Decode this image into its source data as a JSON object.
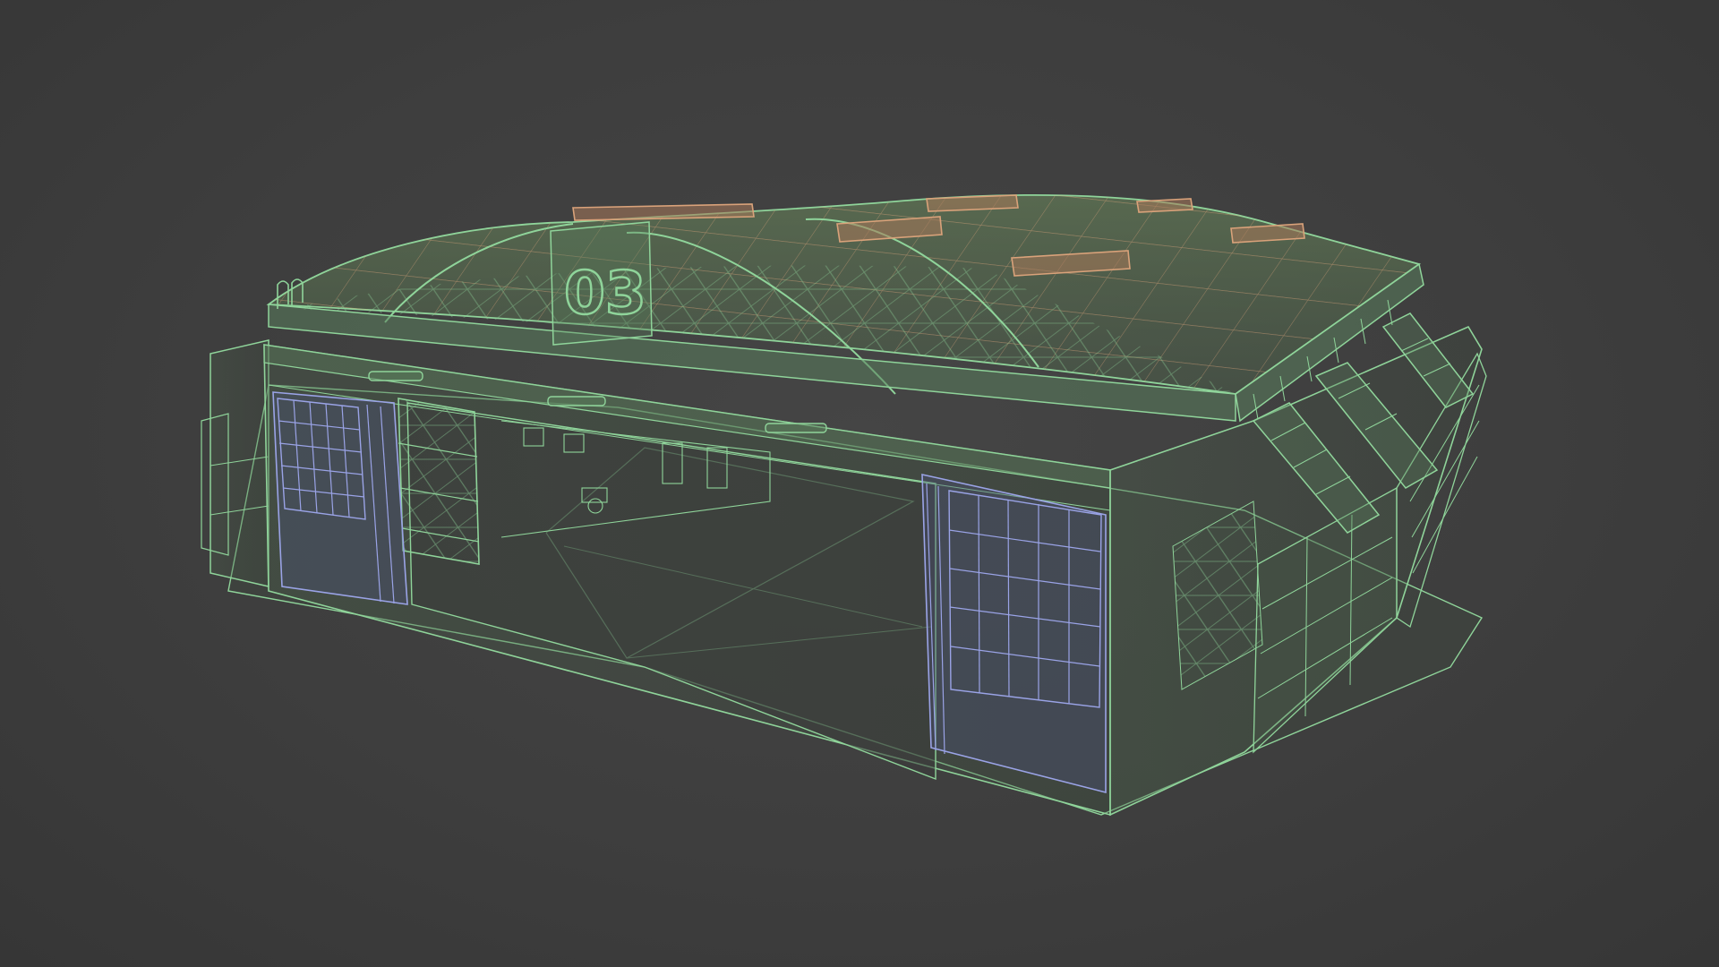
{
  "scene": {
    "title": "",
    "hangar_number": "03",
    "colors": {
      "background": "#3d3d3d",
      "structure_wire": "#8fd49a",
      "structure_fill": "#5a7d5c",
      "roof_panel_wire": "#d9a27a",
      "door_wire": "#9aa3e6"
    },
    "objects": [
      {
        "name": "hangar-shell",
        "color_role": "structure_wire"
      },
      {
        "name": "arched-roof",
        "color_role": "roof_panel_wire"
      },
      {
        "name": "left-hangar-door",
        "color_role": "door_wire"
      },
      {
        "name": "right-hangar-door",
        "color_role": "door_wire"
      },
      {
        "name": "side-staircases",
        "color_role": "structure_wire"
      },
      {
        "name": "interior-scaffold-tower",
        "color_role": "structure_wire"
      }
    ]
  }
}
